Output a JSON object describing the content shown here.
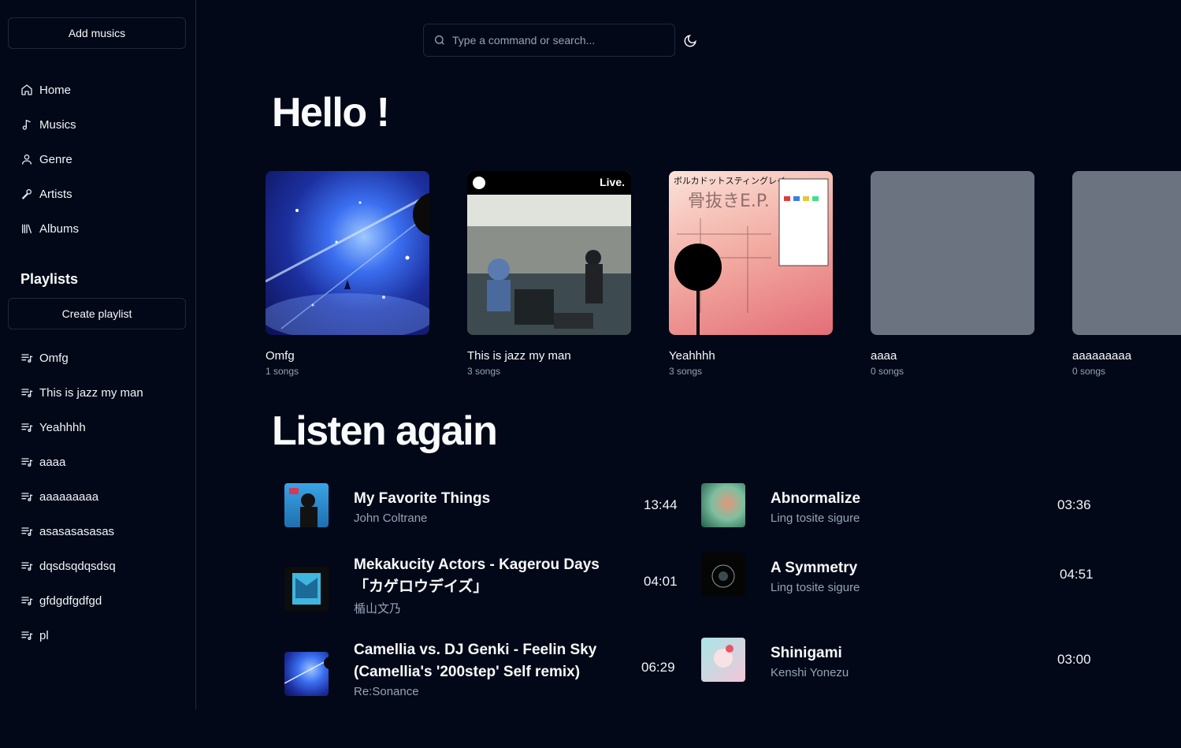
{
  "sidebar": {
    "add_music_label": "Add musics",
    "nav": [
      {
        "label": "Home",
        "icon": "home-icon"
      },
      {
        "label": "Musics",
        "icon": "music-note-icon"
      },
      {
        "label": "Genre",
        "icon": "user-icon"
      },
      {
        "label": "Artists",
        "icon": "microphone-icon"
      },
      {
        "label": "Albums",
        "icon": "library-icon"
      }
    ],
    "playlists_title": "Playlists",
    "create_playlist_label": "Create playlist",
    "playlists": [
      "Omfg",
      "This is jazz my man",
      "Yeahhhh",
      "aaaa",
      "aaaaaaaaa",
      "asasasasasas",
      "dqsdsqdqsdsq",
      "gfdgdfgdfgd",
      "pl"
    ]
  },
  "header": {
    "search_placeholder": "Type a command or search...",
    "theme_icon": "moon-icon"
  },
  "main": {
    "greeting": "Hello !",
    "playlist_cards": [
      {
        "name": "Omfg",
        "count": "1 songs",
        "cover": "galaxy"
      },
      {
        "name": "This is jazz my man",
        "count": "3 songs",
        "cover": "live-concert",
        "badge": "Live."
      },
      {
        "name": "Yeahhhh",
        "count": "3 songs",
        "cover": "pink-illustration",
        "cover_text": "ボルカドットスティングレイ 骨抜きE.P."
      },
      {
        "name": "aaaa",
        "count": "0 songs",
        "cover": "empty"
      },
      {
        "name": "aaaaaaaaa",
        "count": "0 songs",
        "cover": "empty"
      }
    ],
    "listen_again_title": "Listen again",
    "tracks": [
      {
        "title": "My Favorite Things",
        "artist": "John Coltrane",
        "duration": "13:44"
      },
      {
        "title": "Abnormalize",
        "artist": "Ling tosite sigure",
        "duration": "03:36"
      },
      {
        "title": "Mekakucity Actors - Kagerou Days「カゲロウデイズ」",
        "artist": "楯山文乃",
        "duration": "04:01"
      },
      {
        "title": "A Symmetry",
        "artist": "Ling tosite sigure",
        "duration": "04:51"
      },
      {
        "title": "Camellia vs. DJ Genki - Feelin Sky (Camellia's '200step' Self remix)",
        "artist": "Re:Sonance",
        "duration": "06:29"
      },
      {
        "title": "Shinigami",
        "artist": "Kenshi Yonezu",
        "duration": "03:00"
      }
    ]
  }
}
